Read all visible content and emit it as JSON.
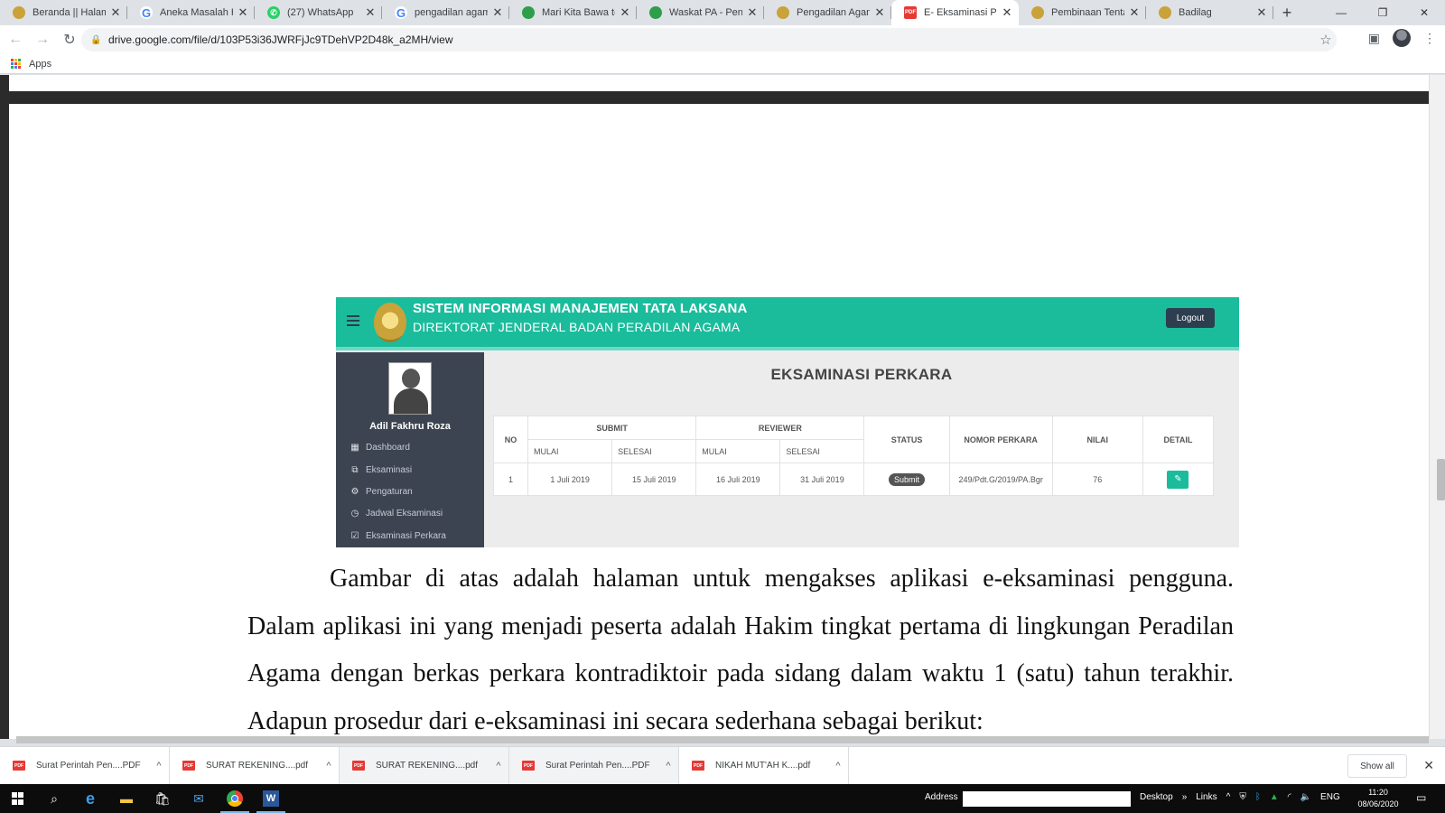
{
  "browser": {
    "tabs": [
      {
        "label": "Beranda || Halaman",
        "favicon": "gold-emblem-icon",
        "active": false
      },
      {
        "label": "Aneka Masalah Huk",
        "favicon": "google-icon",
        "active": false
      },
      {
        "label": "(27) WhatsApp",
        "favicon": "whatsapp-icon",
        "active": false
      },
      {
        "label": "pengadilan agama",
        "favicon": "google-icon",
        "active": false
      },
      {
        "label": "Mari Kita Bawa terb",
        "favicon": "green-emblem-icon",
        "active": false
      },
      {
        "label": "Waskat PA - Pengac",
        "favicon": "green-emblem-icon",
        "active": false
      },
      {
        "label": "Pengadilan Agama",
        "favicon": "gold-emblem-icon",
        "active": false
      },
      {
        "label": "E- Eksaminasi Putus",
        "favicon": "pdf-icon",
        "active": true
      },
      {
        "label": "Pembinaan Tentang",
        "favicon": "gold-emblem-icon",
        "active": false
      },
      {
        "label": "Badilag",
        "favicon": "gold-emblem-icon",
        "active": false
      }
    ],
    "url": "drive.google.com/file/d/103P53i36JWRFjJc9TDehVP2D48k_a2MH/view",
    "bookmarks": {
      "apps_label": "Apps"
    }
  },
  "embedded_app": {
    "title_line1": "SISTEM INFORMASI MANAJEMEN TATA LAKSANA",
    "title_line2": "DIREKTORAT JENDERAL BADAN PERADILAN AGAMA",
    "logout_label": "Logout",
    "user_name": "Adil Fakhru Roza",
    "menu": [
      {
        "label": "Dashboard",
        "icon": "grid-icon"
      },
      {
        "label": "Eksaminasi",
        "icon": "copy-icon"
      },
      {
        "label": "Pengaturan",
        "icon": "cogs-icon"
      },
      {
        "label": "Jadwal Eksaminasi",
        "icon": "clock-icon"
      },
      {
        "label": "Eksaminasi Perkara",
        "icon": "check-square-icon"
      }
    ],
    "page_title": "EKSAMINASI PERKARA",
    "table": {
      "headers": {
        "no": "NO",
        "submit": "SUBMIT",
        "reviewer": "REVIEWER",
        "status": "STATUS",
        "nomor": "NOMOR PERKARA",
        "nilai": "NILAI",
        "detail": "DETAIL",
        "mulai": "MULAI",
        "selesai": "SELESAI"
      },
      "rows": [
        {
          "no": "1",
          "submit_mulai": "1 Juli 2019",
          "submit_selesai": "15 Juli 2019",
          "reviewer_mulai": "16 Juli 2019",
          "reviewer_selesai": "31 Juli 2019",
          "status": "Submit",
          "nomor": "249/Pdt.G/2019/PA.Bgr",
          "nilai": "76"
        }
      ]
    }
  },
  "document": {
    "paragraph": "Gambar di atas adalah halaman untuk mengakses aplikasi e-eksaminasi pengguna. Dalam aplikasi ini yang menjadi peserta adalah Hakim tingkat pertama di lingkungan Peradilan Agama dengan berkas perkara kontradiktoir pada sidang dalam waktu 1 (satu) tahun terakhir. Adapun prosedur dari e-eksaminasi ini secara sederhana sebagai berikut:"
  },
  "downloads": {
    "items": [
      {
        "name": "Surat Perintah Pen....PDF"
      },
      {
        "name": "SURAT REKENING....pdf"
      },
      {
        "name": "SURAT REKENING....pdf"
      },
      {
        "name": "Surat Perintah Pen....PDF"
      },
      {
        "name": "NIKAH MUT'AH  K....pdf"
      }
    ],
    "show_all": "Show all"
  },
  "taskbar": {
    "address_label": "Address",
    "desktop_label": "Desktop",
    "links_label": "Links",
    "lang": "ENG",
    "time": "11:20",
    "date": "08/06/2020"
  }
}
